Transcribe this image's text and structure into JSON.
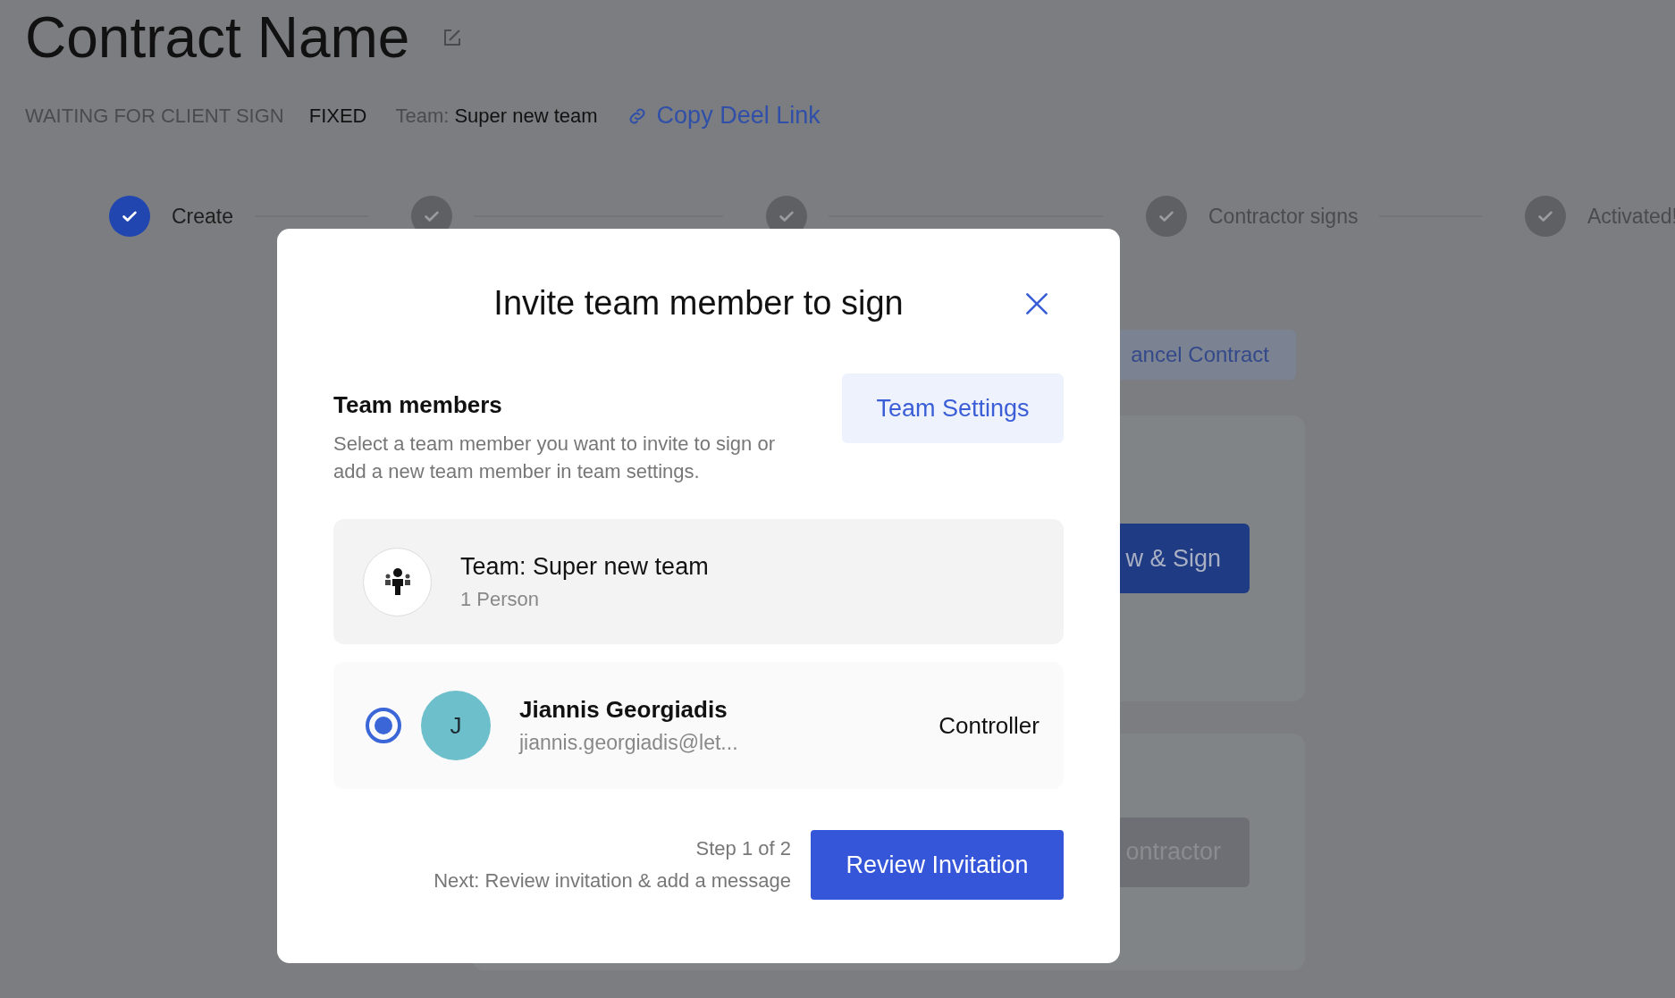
{
  "page": {
    "title": "Contract Name",
    "status": "WAITING FOR CLIENT SIGN",
    "type": "FIXED",
    "team_label": "Team:",
    "team_name": "Super new team",
    "copy_link": "Copy Deel Link"
  },
  "steps": [
    {
      "label": "Create",
      "active": true
    },
    {
      "active": false
    },
    {
      "active": false
    },
    {
      "label": "Contractor signs",
      "active": false
    },
    {
      "label": "Activated!",
      "active": false
    }
  ],
  "background_actions": {
    "cancel": "ancel Contract",
    "sign": "w & Sign",
    "contractor": "ontractor"
  },
  "modal": {
    "title": "Invite team member to sign",
    "section_title": "Team members",
    "description": "Select a team member you want to invite to sign or add a new team member in team settings.",
    "settings_button": "Team Settings",
    "team": {
      "name": "Team: Super new team",
      "count": "1 Person"
    },
    "members": [
      {
        "initial": "J",
        "name": "Jiannis Georgiadis",
        "email": "jiannis.georgiadis@let...",
        "role": "Controller",
        "selected": true,
        "color": "#6cbfcb"
      }
    ],
    "step": "Step 1 of 2",
    "next": "Next: Review invitation & add a message",
    "primary_button": "Review Invitation"
  }
}
